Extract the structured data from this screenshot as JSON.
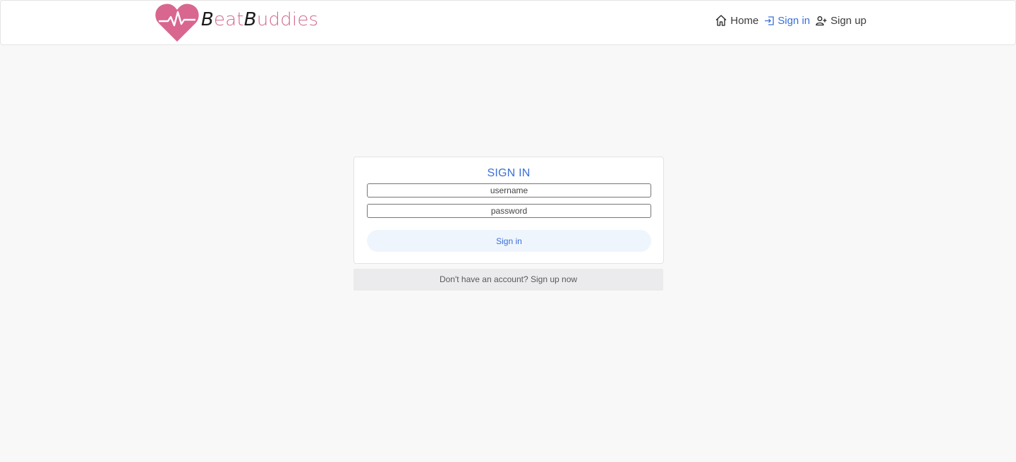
{
  "brand": {
    "first_cap": "B",
    "first_rest": "eat",
    "second_cap": "B",
    "second_rest": "uddies",
    "color": "#d36a8f",
    "logo_icon": "heart-pulse-icon"
  },
  "nav": {
    "home": {
      "label": "Home",
      "icon": "home-icon"
    },
    "signin": {
      "label": "Sign in",
      "icon": "login-icon",
      "color": "#3a6fd8"
    },
    "signup": {
      "label": "Sign up",
      "icon": "person-plus-icon"
    }
  },
  "form": {
    "title": "SIGN IN",
    "username_placeholder": "username",
    "password_placeholder": "password",
    "submit_label": "Sign in"
  },
  "footer_link": {
    "label": "Don't have an account? Sign up now"
  },
  "colors": {
    "accent": "#3a6fd8",
    "background": "#f8f8f8",
    "button_bg": "#eff5fd"
  }
}
